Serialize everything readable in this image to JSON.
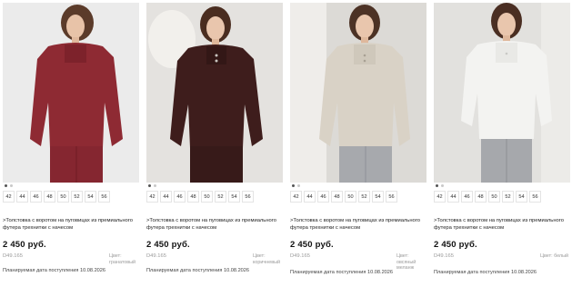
{
  "products": [
    {
      "sizes": [
        "42",
        "44",
        "46",
        "48",
        "50",
        "52",
        "54",
        "56"
      ],
      "title": ">Толстовка с воротом на пуговицах из премиального футера трехнитки с начесом",
      "price": "2 450 руб.",
      "sku": "D49.165",
      "color_label": "Цвет: гранатовый",
      "planned_date": "Планируемая дата поступления 10.08.2026",
      "swatch": "#8e2a33"
    },
    {
      "sizes": [
        "42",
        "44",
        "46",
        "48",
        "50",
        "52",
        "54",
        "56"
      ],
      "title": ">Толстовка с воротом на пуговицах из премиального футера трехнитки с начесом",
      "price": "2 450 руб.",
      "sku": "D49.165",
      "color_label": "Цвет: коричневый",
      "planned_date": "Планируемая дата поступления 10.08.2026",
      "swatch": "#3e1d1c"
    },
    {
      "sizes": [
        "42",
        "44",
        "46",
        "48",
        "50",
        "52",
        "54",
        "56"
      ],
      "title": ">Толстовка с воротом на пуговицах из премиального футера трехнитки с начесом",
      "price": "2 450 руб.",
      "sku": "D49.165",
      "color_label": "Цвет: овсяный меланж",
      "planned_date": "Планируемая дата поступления 10.08.2026",
      "swatch": "#d9d2c6"
    },
    {
      "sizes": [
        "42",
        "44",
        "46",
        "48",
        "50",
        "52",
        "54",
        "56"
      ],
      "title": ">Толстовка с воротом на пуговицах из премиального футера трехнитки с начесом",
      "price": "2 450 руб.",
      "sku": "D49.165",
      "color_label": "Цвет: белый",
      "planned_date": "Планируемая дата поступления 10.08.2026",
      "swatch": "#f3f3f1"
    }
  ]
}
